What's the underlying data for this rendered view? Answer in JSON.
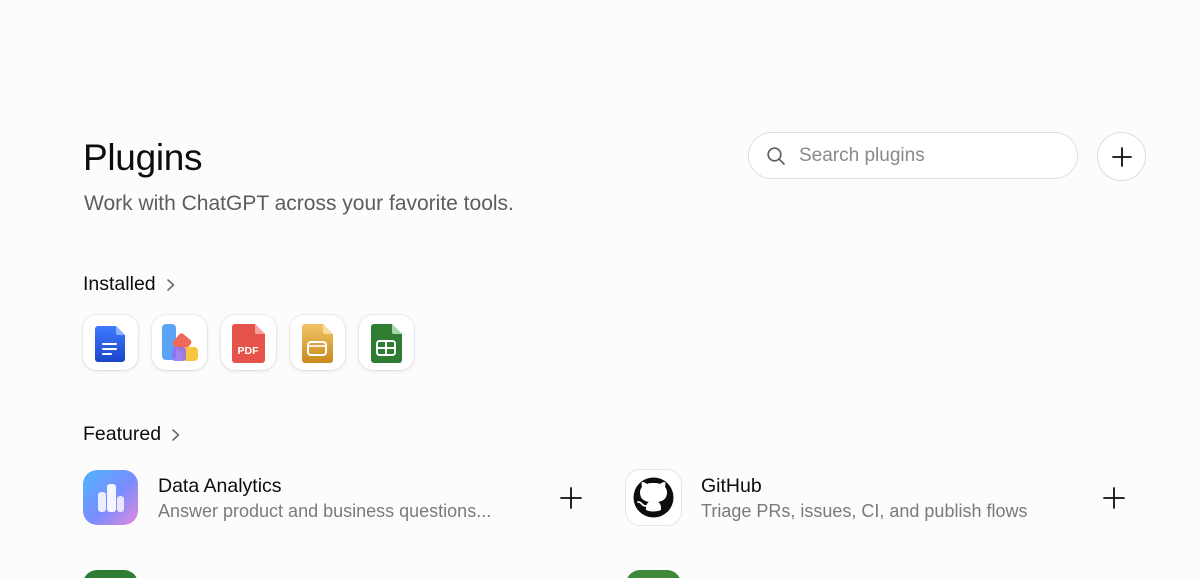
{
  "header": {
    "title": "Plugins",
    "subtitle": "Work with ChatGPT across your favorite tools."
  },
  "search": {
    "placeholder": "Search plugins",
    "value": ""
  },
  "installed": {
    "label": "Installed",
    "apps": [
      {
        "icon": "docs-icon"
      },
      {
        "icon": "design-icon"
      },
      {
        "icon": "pdf-icon",
        "badge_text": "PDF"
      },
      {
        "icon": "slides-icon"
      },
      {
        "icon": "sheets-icon"
      }
    ]
  },
  "featured": {
    "label": "Featured",
    "items": [
      {
        "name": "Data Analytics",
        "description": "Answer product and business questions...",
        "icon": "data-analytics-icon"
      },
      {
        "name": "GitHub",
        "description": "Triage PRs, issues, CI, and publish flows",
        "icon": "github-icon"
      }
    ]
  },
  "colors": {
    "background": "#fcfcfc",
    "docs_blue": "#2b5fe0",
    "pdf_red": "#e5534b",
    "slides_gold": "#d6a53a",
    "sheets_green": "#2f7d32"
  }
}
